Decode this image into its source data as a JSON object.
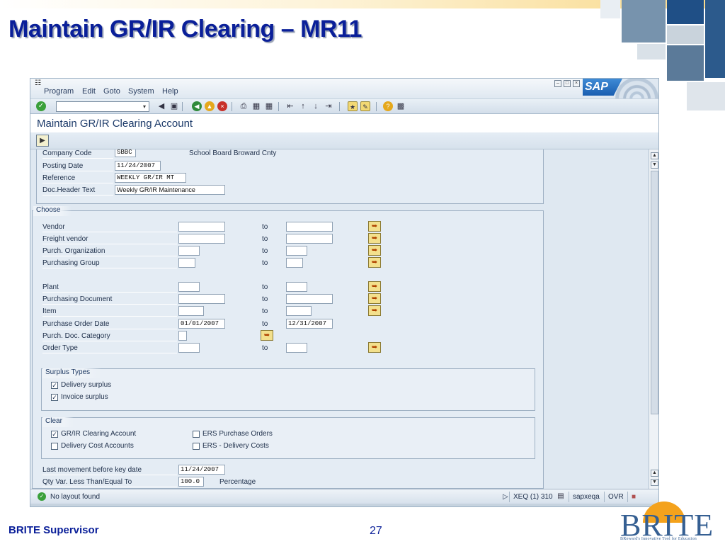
{
  "slide": {
    "title": "Maintain GR/IR Clearing – MR11",
    "footer_left": "BRITE Supervisor",
    "page_number": "27",
    "logo_word": "BRITE",
    "logo_tagline": "BRoward's Innovative Tool for Education"
  },
  "sap": {
    "menu": [
      "Program",
      "Edit",
      "Goto",
      "System",
      "Help"
    ],
    "logo": "SAP",
    "screen_title": "Maintain GR/IR Clearing Account",
    "header": {
      "company_code_label": "Company Code",
      "company_code": "SBBC",
      "company_name": "School Board Broward Cnty",
      "posting_date_label": "Posting Date",
      "posting_date": "11/24/2007",
      "reference_label": "Reference",
      "reference": "WEEKLY GR/IR MT",
      "doc_header_label": "Doc.Header Text",
      "doc_header": "Weekly GR/IR Maintenance"
    },
    "choose": {
      "title": "Choose",
      "to_label": "to",
      "rows": [
        {
          "label": "Vendor",
          "from": "",
          "to": ""
        },
        {
          "label": "Freight vendor",
          "from": "",
          "to": ""
        },
        {
          "label": "Purch. Organization",
          "from": "",
          "to": ""
        },
        {
          "label": "Purchasing Group",
          "from": "",
          "to": ""
        },
        {
          "label": "Plant",
          "from": "",
          "to": ""
        },
        {
          "label": "Purchasing Document",
          "from": "",
          "to": ""
        },
        {
          "label": "Item",
          "from": "",
          "to": ""
        },
        {
          "label": "Purchase Order Date",
          "from": "01/01/2007",
          "to": "12/31/2007"
        },
        {
          "label": "Purch. Doc. Category",
          "from": ""
        },
        {
          "label": "Order Type",
          "from": "",
          "to": ""
        }
      ]
    },
    "surplus": {
      "title": "Surplus Types",
      "delivery": "Delivery surplus",
      "delivery_checked": true,
      "invoice": "Invoice surplus",
      "invoice_checked": true
    },
    "clear": {
      "title": "Clear",
      "grir": "GR/IR Clearing Account",
      "grir_checked": true,
      "ers_po": "ERS Purchase Orders",
      "ers_po_checked": false,
      "delivery_cost": "Delivery Cost Accounts",
      "delivery_cost_checked": false,
      "ers_delivery": "ERS - Delivery Costs",
      "ers_delivery_checked": false
    },
    "footer_fields": {
      "last_movement_label": "Last movement before key date",
      "last_movement": "11/24/2007",
      "qty_var_label": "Qty Var. Less Than/Equal To",
      "qty_var": "100.0",
      "percentage_label": "Percentage"
    },
    "status": {
      "message": "No layout found",
      "system": "XEQ (1) 310",
      "server": "sapxeqa",
      "mode": "OVR"
    }
  }
}
